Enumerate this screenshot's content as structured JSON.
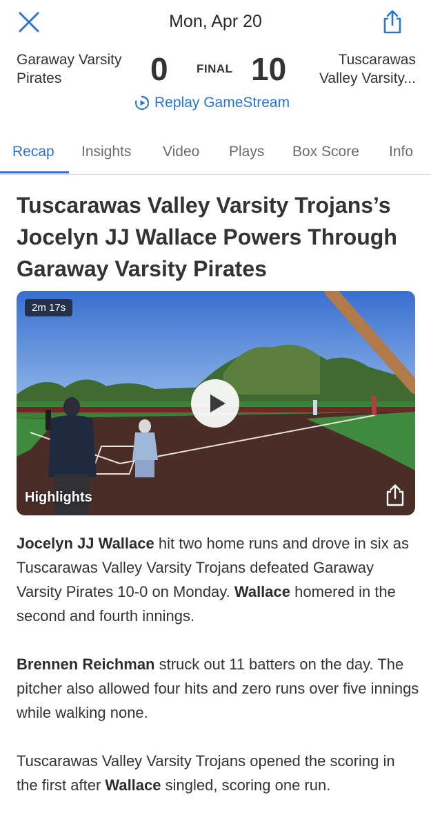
{
  "header": {
    "date": "Mon, Apr 20",
    "close_icon": "close-icon",
    "share_icon": "share-icon"
  },
  "scoreboard": {
    "home_team": "Garaway Varsity Pirates",
    "home_score": "0",
    "status": "FINAL",
    "away_score": "10",
    "away_team_line1": "Tuscarawas",
    "away_team_line2": "Valley Varsity...",
    "replay_label": "Replay GameStream"
  },
  "tabs": [
    {
      "label": "Recap",
      "active": true
    },
    {
      "label": "Insights"
    },
    {
      "label": "Video"
    },
    {
      "label": "Plays"
    },
    {
      "label": "Box Score"
    },
    {
      "label": "Info"
    }
  ],
  "article": {
    "headline": "Tuscarawas Valley Varsity Trojans’s Jocelyn JJ Wallace Powers Through Garaway Varsity Pirates",
    "video": {
      "duration": "2m 17s",
      "label": "Highlights"
    },
    "p1": {
      "name": "Jocelyn JJ Wallace",
      "text1": " hit two home runs and drove in six as Tuscarawas Valley Varsity Trojans defeated Garaway Varsity Pirates 10-0 on Monday. ",
      "name2": "Wallace",
      "text2": " homered in the second and fourth innings."
    },
    "p2": {
      "name": "Brennen Reichman",
      "text": " struck out 11 batters on the day. The pitcher also allowed four hits and zero runs over five innings while walking none."
    },
    "p3": {
      "text1": "Tuscarawas Valley Varsity Trojans opened the scoring in the first after ",
      "name": "Wallace",
      "text2": " singled, scoring one run."
    }
  },
  "colors": {
    "accent": "#2a74c9",
    "text": "#333333",
    "muted": "#6a6a6a"
  }
}
